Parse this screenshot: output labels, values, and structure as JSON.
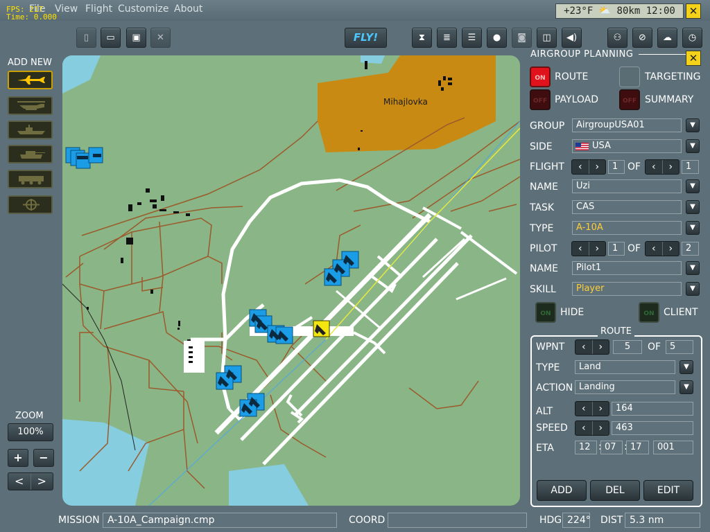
{
  "debug": {
    "fps": "FPS: 217",
    "time": "Time: 0.000"
  },
  "menu": [
    "File",
    "View",
    "Flight",
    "Customize",
    "About"
  ],
  "weather": "+23°F ⛅ 80km 12:00",
  "toolbar": {
    "fly_label": "FLY!"
  },
  "left": {
    "add_new": "ADD NEW",
    "add_items": [
      "aircraft-icon",
      "helicopter-icon",
      "ship-icon",
      "tank-icon",
      "vehicle-icon",
      "static-object-icon"
    ],
    "zoom_label": "ZOOM",
    "zoom_value": "100%",
    "plus": "+",
    "minus": "−"
  },
  "map": {
    "town": "Mihajlovka"
  },
  "panel": {
    "title": "AIRGROUP PLANNING",
    "toggles": {
      "route": "ROUTE",
      "targeting": "TARGETING",
      "payload": "PAYLOAD",
      "summary": "SUMMARY",
      "on": "ON",
      "off": "OFF"
    },
    "group_label": "GROUP",
    "group": "AirgroupUSA01",
    "side_label": "SIDE",
    "side": "USA",
    "flight_label": "FLIGHT",
    "flight": "1",
    "of": "OF",
    "flight_total": "1",
    "name_label": "NAME",
    "name": "Uzi",
    "task_label": "TASK",
    "task": "CAS",
    "type_label": "TYPE",
    "type": "A-10A",
    "pilot_label": "PILOT",
    "pilot": "1",
    "pilot_total": "2",
    "pilot_name_label": "NAME",
    "pilot_name": "Pilot1",
    "skill_label": "SKILL",
    "skill": "Player",
    "hide_label": "HIDE",
    "client_label": "CLIENT"
  },
  "route": {
    "title": "ROUTE",
    "wpnt_label": "WPNT",
    "wpnt": "5",
    "of": "OF",
    "wpnt_total": "5",
    "type_label": "TYPE",
    "type": "Land",
    "action_label": "ACTION",
    "action": "Landing",
    "alt_label": "ALT",
    "alt": "164",
    "speed_label": "SPEED",
    "speed": "463",
    "eta_label": "ETA",
    "eta": [
      "12",
      "07",
      "17",
      "001"
    ],
    "add": "ADD",
    "del": "DEL",
    "edit": "EDIT"
  },
  "status": {
    "mission_label": "MISSION",
    "mission": "A-10A_Campaign.cmp",
    "coord_label": "COORD",
    "coord": "",
    "hdg_label": "HDG",
    "hdg": "224°",
    "dist_label": "DIST",
    "dist": "5.3 nm"
  }
}
